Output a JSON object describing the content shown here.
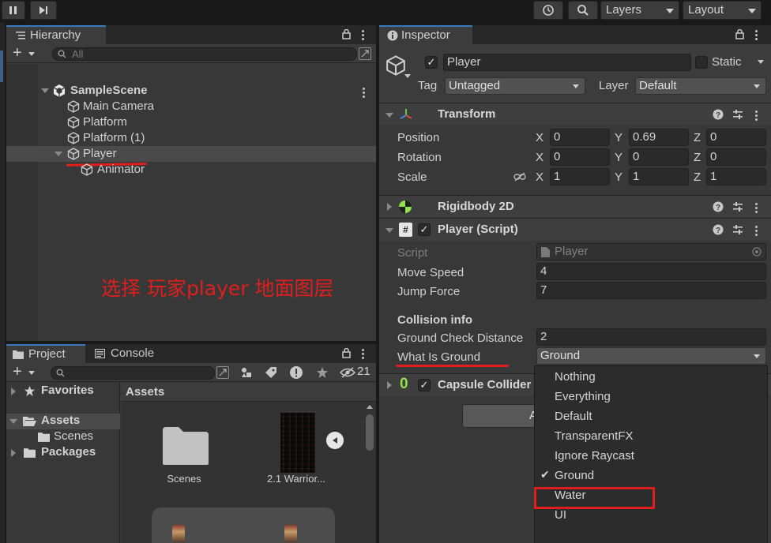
{
  "toolbar": {
    "layers_label": "Layers",
    "layout_label": "Layout",
    "icons": [
      "pause-icon",
      "step-icon",
      "history-icon",
      "search-icon"
    ]
  },
  "hierarchy": {
    "tab_label": "Hierarchy",
    "search_placeholder": "All",
    "scene_name": "SampleScene",
    "items": [
      {
        "label": "Main Camera"
      },
      {
        "label": "Platform"
      },
      {
        "label": "Platform (1)"
      },
      {
        "label": "Player"
      },
      {
        "label": "Animator"
      }
    ],
    "annotation": "选择 玩家player 地面图层"
  },
  "project": {
    "project_tab": "Project",
    "console_tab": "Console",
    "hidden_count": "21",
    "tree": {
      "favorites": "Favorites",
      "assets": "Assets",
      "scenes": "Scenes",
      "packages": "Packages"
    },
    "breadcrumb": "Assets",
    "assets": [
      {
        "label": "Scenes"
      },
      {
        "label": "2.1 Warrior..."
      }
    ]
  },
  "inspector": {
    "tab_label": "Inspector",
    "object_name": "Player",
    "static_label": "Static",
    "tag_label": "Tag",
    "tag_value": "Untagged",
    "layer_label": "Layer",
    "layer_value": "Default",
    "transform": {
      "title": "Transform",
      "position_label": "Position",
      "rotation_label": "Rotation",
      "scale_label": "Scale",
      "position": {
        "x": "0",
        "y": "0.69",
        "z": "0"
      },
      "rotation": {
        "x": "0",
        "y": "0",
        "z": "0"
      },
      "scale": {
        "x": "1",
        "y": "1",
        "z": "1"
      },
      "axis_x": "X",
      "axis_y": "Y",
      "axis_z": "Z"
    },
    "rigidbody": {
      "title": "Rigidbody 2D"
    },
    "player_script": {
      "title": "Player (Script)",
      "script_label": "Script",
      "script_value": "Player",
      "move_speed_label": "Move Speed",
      "move_speed_value": "4",
      "jump_force_label": "Jump Force",
      "jump_force_value": "7",
      "collision_header": "Collision info",
      "ground_check_label": "Ground Check Distance",
      "ground_check_value": "2",
      "what_is_ground_label": "What Is Ground",
      "what_is_ground_value": "Ground"
    },
    "capsule_collider": {
      "title": "Capsule Collider"
    },
    "add_component_partial": "A"
  },
  "layer_menu": {
    "items": [
      "Nothing",
      "Everything",
      "Default",
      "TransparentFX",
      "Ignore Raycast",
      "Ground",
      "Water",
      "UI"
    ],
    "selected": "Ground",
    "check": "✔"
  },
  "colors": {
    "annotation_red": "#e01e1e",
    "accent_blue": "#3a79bb",
    "panel_bg": "#383838"
  }
}
